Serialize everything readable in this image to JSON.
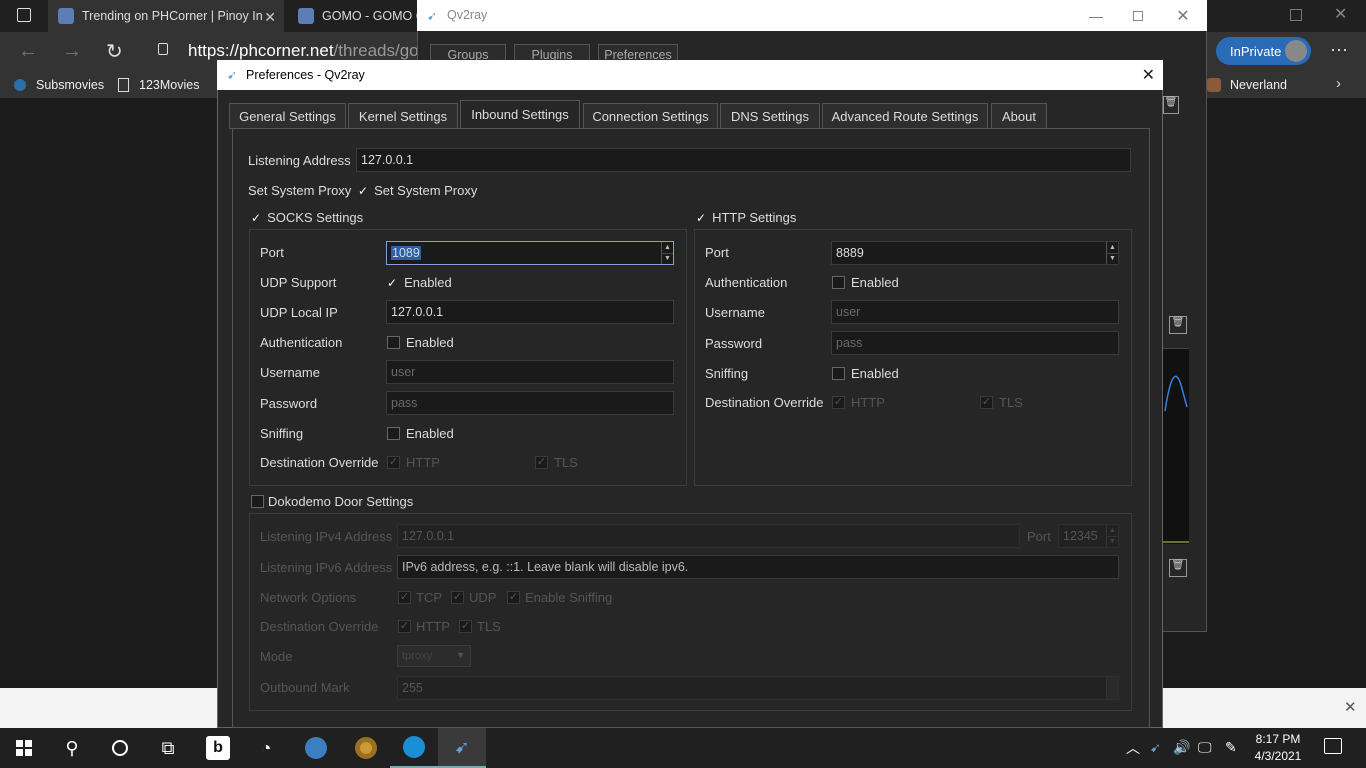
{
  "browser": {
    "tabs": [
      {
        "title": "Trending on PHCorner | Pinoy In"
      },
      {
        "title": "GOMO - GOMO C"
      }
    ],
    "address": {
      "host": "https://phcorner.net",
      "path": "/threads/go"
    },
    "inprivate_label": "InPrivate",
    "bookmarks": [
      "Subsmovies",
      "123Movies",
      "Neverland"
    ]
  },
  "qv2ray": {
    "title": "Qv2ray",
    "top_buttons": [
      "Groups",
      "Plugins",
      "Preferences"
    ]
  },
  "dialog": {
    "title": "Preferences - Qv2ray",
    "tabs": [
      "General Settings",
      "Kernel Settings",
      "Inbound Settings",
      "Connection Settings",
      "DNS Settings",
      "Advanced Route Settings",
      "About"
    ],
    "active_tab": "Inbound Settings",
    "listening_address_label": "Listening Address",
    "listening_address_value": "127.0.0.1",
    "system_proxy_label": "Set System Proxy",
    "system_proxy_checkbox": "Set System Proxy",
    "socks": {
      "title": "SOCKS Settings",
      "port_label": "Port",
      "port_value": "1089",
      "udp_support_label": "UDP Support",
      "udp_support_value": "Enabled",
      "udp_local_ip_label": "UDP Local IP",
      "udp_local_ip_value": "127.0.0.1",
      "auth_label": "Authentication",
      "auth_value": "Enabled",
      "username_label": "Username",
      "username_placeholder": "user",
      "password_label": "Password",
      "password_placeholder": "pass",
      "sniffing_label": "Sniffing",
      "sniffing_value": "Enabled",
      "dest_override_label": "Destination Override",
      "dest_http": "HTTP",
      "dest_tls": "TLS"
    },
    "http": {
      "title": "HTTP Settings",
      "port_label": "Port",
      "port_value": "8889",
      "auth_label": "Authentication",
      "auth_value": "Enabled",
      "username_label": "Username",
      "username_placeholder": "user",
      "password_label": "Password",
      "password_placeholder": "pass",
      "sniffing_label": "Sniffing",
      "sniffing_value": "Enabled",
      "dest_override_label": "Destination Override",
      "dest_http": "HTTP",
      "dest_tls": "TLS"
    },
    "dokodemo": {
      "title": "Dokodemo Door Settings",
      "ipv4_label": "Listening IPv4 Address",
      "ipv4_value": "127.0.0.1",
      "port_label": "Port",
      "port_value": "12345",
      "ipv6_label": "Listening IPv6 Address",
      "ipv6_placeholder": "IPv6 address, e.g. ::1. Leave blank will disable ipv6.",
      "network_label": "Network Options",
      "network_tcp": "TCP",
      "network_udp": "UDP",
      "network_sniffing": "Enable Sniffing",
      "dest_override_label": "Destination Override",
      "dest_http": "HTTP",
      "dest_tls": "TLS",
      "mode_label": "Mode",
      "mode_value": "tproxy",
      "outbound_mark_label": "Outbound Mark",
      "outbound_mark_value": "255"
    }
  },
  "taskbar": {
    "time": "8:17 PM",
    "date": "4/3/2021"
  }
}
